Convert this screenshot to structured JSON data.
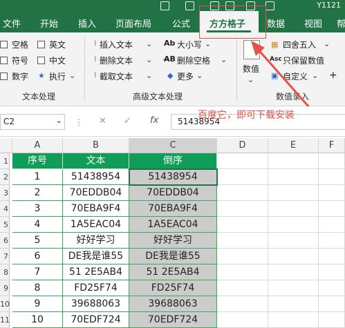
{
  "titlebar": {
    "right_text": "Y1121"
  },
  "menu": {
    "tabs": [
      "文件",
      "开始",
      "插入",
      "页面布局",
      "公式",
      "方方格子",
      "数据",
      "视图",
      "帮"
    ],
    "active_tab": "方方格子"
  },
  "ribbon": {
    "text_group": {
      "checkboxes": [
        "空格",
        "英文",
        "符号",
        "中文",
        "数字"
      ],
      "exec_label": "执行",
      "title": "文本处理"
    },
    "adv_group": {
      "buttons": [
        "插入文本",
        "删除文本",
        "截取文本"
      ],
      "buttons2": [
        "大小写",
        "删除空格",
        "更多"
      ],
      "title": "高级文本处理"
    },
    "num_group": {
      "big_button": "数值",
      "items": [
        "四舍五入",
        "只保留数值",
        "自定义"
      ],
      "title": "数值录入"
    }
  },
  "formula_bar": {
    "name_box": "C2",
    "fx_label": "fx",
    "value": "51438954"
  },
  "watermark": "百度它，即可下载安装",
  "columns": [
    "A",
    "B",
    "C",
    "D",
    "E",
    "F"
  ],
  "row_numbers": [
    "1",
    "2",
    "3",
    "4",
    "5",
    "6",
    "7",
    "8",
    "9",
    "10",
    "11"
  ],
  "table": {
    "headers": [
      "序号",
      "文本",
      "倒序"
    ],
    "rows": [
      [
        "1",
        "51438954",
        "51438954"
      ],
      [
        "2",
        "70EDDB04",
        "70EDDB04"
      ],
      [
        "3",
        "70EBA9F4",
        "70EBA9F4"
      ],
      [
        "4",
        "1A5EAC04",
        "1A5EAC04"
      ],
      [
        "5",
        "好好学习",
        "好好学习"
      ],
      [
        "6",
        "DE我是谁55",
        "DE我是谁55"
      ],
      [
        "7",
        "51 2E5AB4",
        "51 2E5AB4"
      ],
      [
        "8",
        "FD25F74",
        "FD25F74"
      ],
      [
        "9",
        "39688063",
        "39688063"
      ],
      [
        "10",
        "70EDF724",
        "70EDF724"
      ]
    ]
  }
}
